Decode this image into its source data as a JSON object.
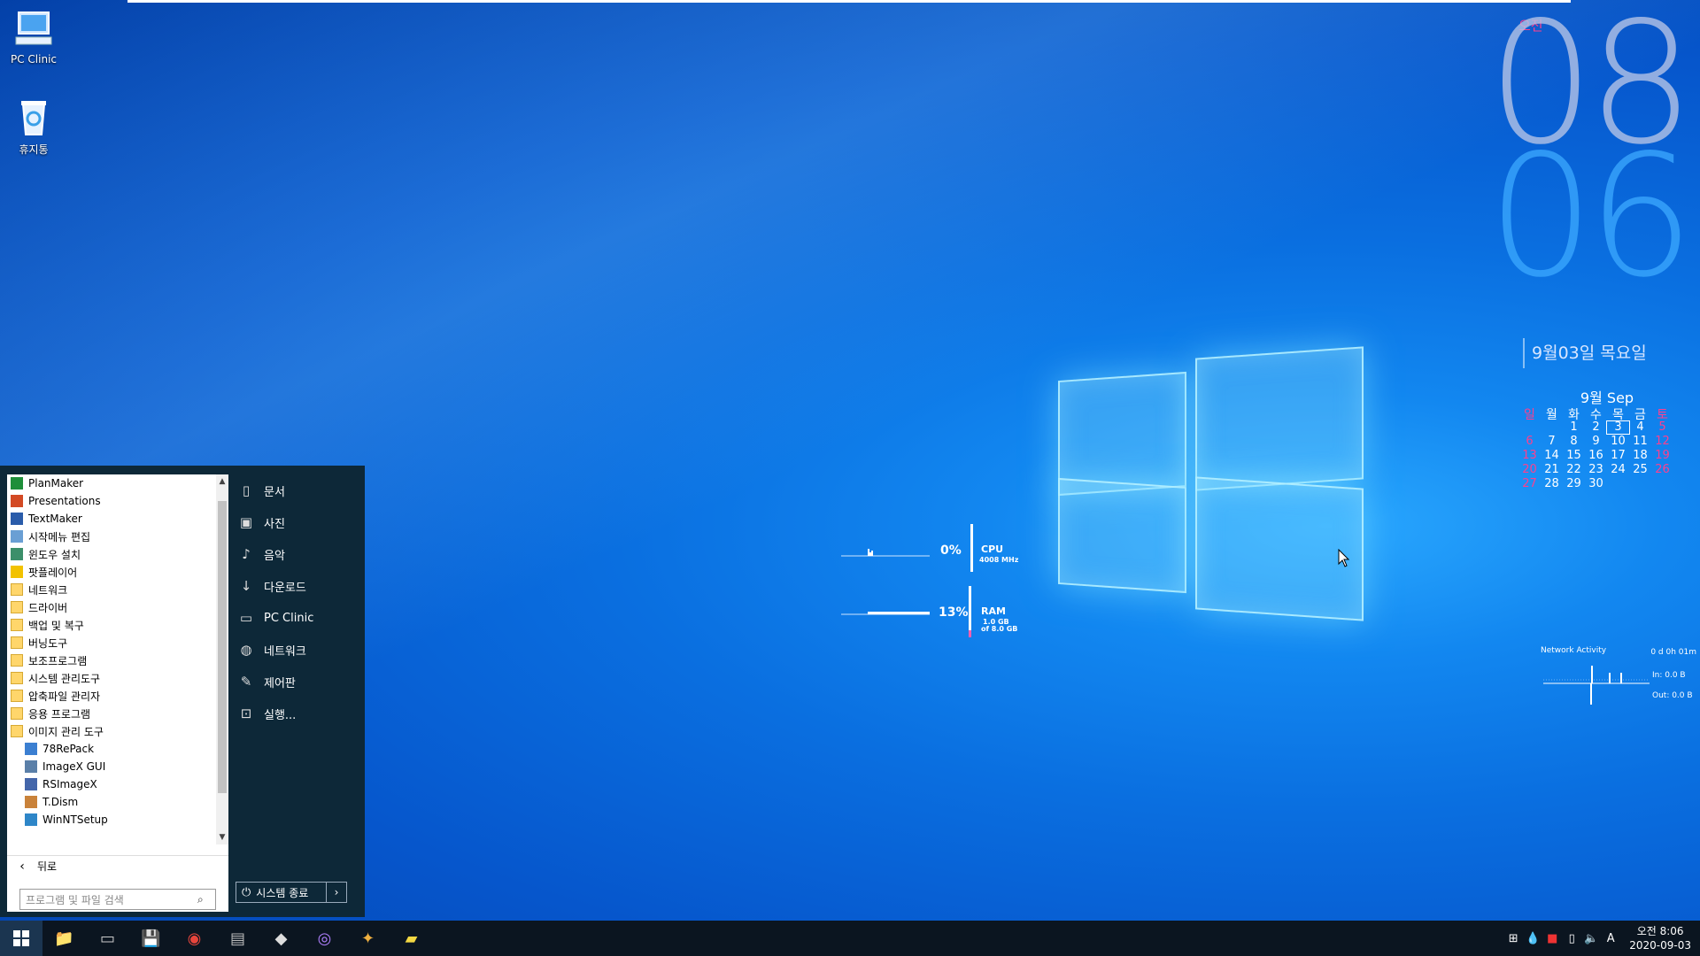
{
  "desktop": {
    "icons": [
      {
        "label": "PC Clinic",
        "icon": "computer-icon"
      },
      {
        "label": "휴지통",
        "icon": "recycle-bin-icon"
      }
    ]
  },
  "clock": {
    "ampm": "오전",
    "hour": "08",
    "minute": "06",
    "date": "9월03일 목요일"
  },
  "calendar": {
    "title": "9월 Sep",
    "weekdays": [
      "일",
      "월",
      "화",
      "수",
      "목",
      "금",
      "토"
    ],
    "today": "3",
    "weeks": [
      [
        "",
        "",
        "1",
        "2",
        "3",
        "4",
        "5"
      ],
      [
        "6",
        "7",
        "8",
        "9",
        "10",
        "11",
        "12"
      ],
      [
        "13",
        "14",
        "15",
        "16",
        "17",
        "18",
        "19"
      ],
      [
        "20",
        "21",
        "22",
        "23",
        "24",
        "25",
        "26"
      ],
      [
        "27",
        "28",
        "29",
        "30",
        "",
        "",
        ""
      ]
    ]
  },
  "gadget": {
    "cpu": {
      "percent": "0%",
      "label": "CPU",
      "detail": "4008 MHz"
    },
    "ram": {
      "percent": "13%",
      "label": "RAM",
      "detail1": "1.0 GB",
      "detail2": "of 8.0 GB",
      "fill": 0.13
    }
  },
  "network": {
    "title": "Network Activity",
    "uptime": "0 d 0h 01m",
    "in": "In: 0.0 B",
    "out": "Out: 0.0 B"
  },
  "start_menu": {
    "programs": [
      {
        "label": "PlanMaker",
        "icon": "planmaker-icon",
        "color": "#1e8f3a",
        "sub": false
      },
      {
        "label": "Presentations",
        "icon": "presentations-icon",
        "color": "#d34a24",
        "sub": false
      },
      {
        "label": "TextMaker",
        "icon": "textmaker-icon",
        "color": "#2a5caa",
        "sub": false
      },
      {
        "label": "시작메뉴 편집",
        "icon": "menu-edit-icon",
        "color": "#6a9fd4",
        "sub": false
      },
      {
        "label": "윈도우 설치",
        "icon": "windows-setup-icon",
        "color": "#3c8f6a",
        "sub": false
      },
      {
        "label": "팟플레이어",
        "icon": "potplayer-icon",
        "color": "#f2c200",
        "sub": false
      },
      {
        "label": "네트워크",
        "icon": "folder-icon",
        "color": "",
        "sub": false
      },
      {
        "label": "드라이버",
        "icon": "folder-icon",
        "color": "",
        "sub": false
      },
      {
        "label": "백업 및 복구",
        "icon": "folder-icon",
        "color": "",
        "sub": false
      },
      {
        "label": "버닝도구",
        "icon": "folder-icon",
        "color": "",
        "sub": false
      },
      {
        "label": "보조프로그램",
        "icon": "folder-icon",
        "color": "",
        "sub": false
      },
      {
        "label": "시스템 관리도구",
        "icon": "folder-icon",
        "color": "",
        "sub": false
      },
      {
        "label": "압축파일 관리자",
        "icon": "folder-icon",
        "color": "",
        "sub": false
      },
      {
        "label": "응용 프로그램",
        "icon": "folder-icon",
        "color": "",
        "sub": false
      },
      {
        "label": "이미지 관리 도구",
        "icon": "folder-icon",
        "color": "",
        "sub": false
      },
      {
        "label": "78RePack",
        "icon": "78repack-icon",
        "color": "#3b7fd1",
        "sub": true
      },
      {
        "label": "ImageX GUI",
        "icon": "imagex-icon",
        "color": "#5a7fa8",
        "sub": true
      },
      {
        "label": "RSImageX",
        "icon": "rsimagex-icon",
        "color": "#4466aa",
        "sub": true
      },
      {
        "label": "T.Dism",
        "icon": "tdism-icon",
        "color": "#c9823a",
        "sub": true
      },
      {
        "label": "WinNTSetup",
        "icon": "winntsetup-icon",
        "color": "#2e86c8",
        "sub": true
      }
    ],
    "back_label": "뒤로",
    "search_placeholder": "프로그램 및 파일 검색",
    "right_items": [
      {
        "label": "문서",
        "icon": "document-icon",
        "glyph": "▯"
      },
      {
        "label": "사진",
        "icon": "pictures-icon",
        "glyph": "▣"
      },
      {
        "label": "음악",
        "icon": "music-icon",
        "glyph": "♪"
      },
      {
        "label": "다운로드",
        "icon": "download-icon",
        "glyph": "↓"
      },
      {
        "label": "PC Clinic",
        "icon": "computer-icon",
        "glyph": "▭"
      },
      {
        "label": "네트워크",
        "icon": "network-icon",
        "glyph": "◍"
      },
      {
        "label": "제어판",
        "icon": "control-panel-icon",
        "glyph": "✎"
      },
      {
        "label": "실행...",
        "icon": "run-icon",
        "glyph": "⊡"
      }
    ],
    "shutdown_label": "시스템 종료"
  },
  "taskbar": {
    "apps": [
      {
        "name": "file-explorer-icon",
        "glyph": "📁",
        "color": "#f3c843"
      },
      {
        "name": "cmd-icon",
        "glyph": "▭",
        "color": "#cccccc"
      },
      {
        "name": "save-disk-icon",
        "glyph": "💾",
        "color": "#3a6fd8"
      },
      {
        "name": "chrome-icon",
        "glyph": "◉",
        "color": "#e8453c"
      },
      {
        "name": "disk-tool-icon",
        "glyph": "▤",
        "color": "#bbbbbb"
      },
      {
        "name": "usb-tool-icon",
        "glyph": "◆",
        "color": "#dddddd"
      },
      {
        "name": "disc-burner-icon",
        "glyph": "◎",
        "color": "#b080ff"
      },
      {
        "name": "control-tools-icon",
        "glyph": "✦",
        "color": "#f0b040"
      },
      {
        "name": "folder-app-icon",
        "glyph": "▰",
        "color": "#f3d843"
      }
    ],
    "time": "오전 8:06",
    "date": "2020-09-03",
    "ime": "A"
  }
}
